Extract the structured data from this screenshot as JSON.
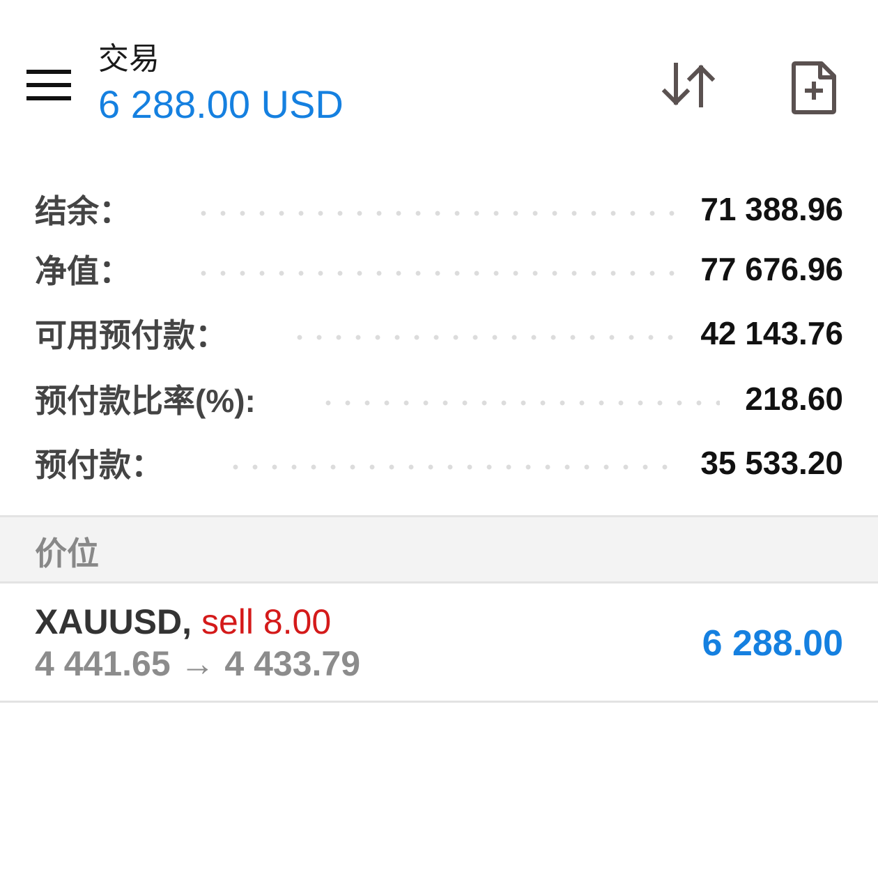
{
  "header": {
    "title": "交易",
    "profit": "6 288.00 USD",
    "menu_icon": "hamburger-menu-icon",
    "sort_icon": "sort-arrows-icon",
    "new_order_icon": "document-plus-icon"
  },
  "summary": [
    {
      "label": "结余：",
      "value": "71 388.96"
    },
    {
      "label": "净值：",
      "value": "77 676.96"
    },
    {
      "label": "可用预付款：",
      "value": "42 143.76"
    },
    {
      "label": "预付款比率(%):",
      "value": "218.60"
    },
    {
      "label": "预付款：",
      "value": "35 533.20"
    }
  ],
  "positions_section": {
    "title": "价位"
  },
  "positions": [
    {
      "symbol": "XAUUSD,",
      "side_volume": "sell 8.00",
      "prices": "4 441.65 → 4 433.79",
      "profit": "6 288.00"
    }
  ],
  "colors": {
    "accent_blue": "#1580e0",
    "sell_red": "#d41a1a",
    "icon_gray": "#5a5150"
  }
}
